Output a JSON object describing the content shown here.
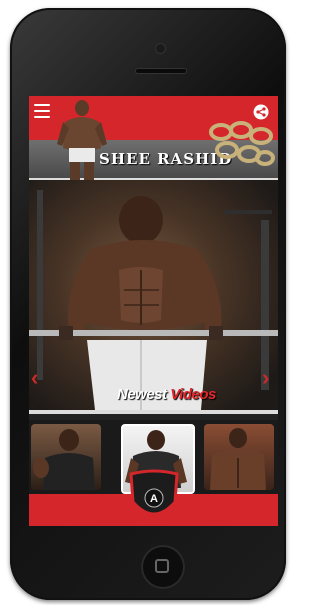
{
  "header": {
    "brand_text": "SHEE RASHID",
    "menu_icon": "hamburger-menu-icon",
    "share_icon": "share-icon"
  },
  "hero": {
    "prev_arrow": "‹",
    "next_arrow": "›"
  },
  "section": {
    "title_white": "Newest",
    "title_red": "Videos"
  },
  "colors": {
    "accent_red": "#d4262b",
    "dark": "#1a1a1a"
  },
  "videos": [
    {
      "icon": "video-thumbnail"
    },
    {
      "icon": "video-thumbnail"
    },
    {
      "icon": "video-thumbnail"
    }
  ],
  "badge_letter": "A"
}
